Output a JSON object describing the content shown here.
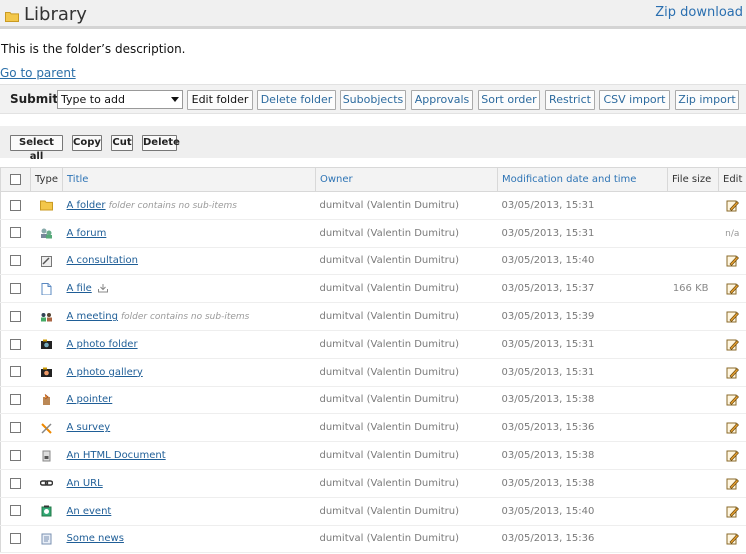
{
  "header": {
    "title": "Library",
    "zip_download": "Zip download"
  },
  "description": "This is the folder’s description.",
  "go_to_parent": "Go to parent",
  "submit": {
    "label": "Submit:",
    "select_value": "Type to add",
    "buttons": [
      "Edit folder",
      "Delete folder",
      "Subobjects",
      "Approvals",
      "Sort order",
      "Restrict",
      "CSV import",
      "Zip import"
    ]
  },
  "actions": [
    "Select all",
    "Copy",
    "Cut",
    "Delete"
  ],
  "table": {
    "headers": {
      "type": "Type",
      "title": "Title",
      "owner": "Owner",
      "modified": "Modification date and time",
      "size": "File size",
      "edit": "Edit"
    },
    "rows": [
      {
        "icon": "folder-icon",
        "title": "A folder",
        "note": "folder contains no sub-items",
        "owner": "dumitval (Valentin Dumitru)",
        "date": "03/05/2013, 15:31",
        "size": "",
        "edit": "edit-icon"
      },
      {
        "icon": "forum-icon",
        "title": "A forum",
        "note": "",
        "owner": "dumitval (Valentin Dumitru)",
        "date": "03/05/2013, 15:31",
        "size": "",
        "edit": "n/a"
      },
      {
        "icon": "consultation-icon",
        "title": "A consultation",
        "note": "",
        "owner": "dumitval (Valentin Dumitru)",
        "date": "03/05/2013, 15:40",
        "size": "",
        "edit": "edit-icon"
      },
      {
        "icon": "file-icon",
        "title": "A file",
        "note": "",
        "download": true,
        "owner": "dumitval (Valentin Dumitru)",
        "date": "03/05/2013, 15:37",
        "size": "166 KB",
        "edit": "edit-icon"
      },
      {
        "icon": "meeting-icon",
        "title": "A meeting",
        "note": "folder contains no sub-items",
        "owner": "dumitval (Valentin Dumitru)",
        "date": "03/05/2013, 15:39",
        "size": "",
        "edit": "edit-icon"
      },
      {
        "icon": "photo-folder-icon",
        "title": "A photo folder",
        "note": "",
        "owner": "dumitval (Valentin Dumitru)",
        "date": "03/05/2013, 15:31",
        "size": "",
        "edit": "edit-icon"
      },
      {
        "icon": "photo-gallery-icon",
        "title": "A photo gallery",
        "note": "",
        "owner": "dumitval (Valentin Dumitru)",
        "date": "03/05/2013, 15:31",
        "size": "",
        "edit": "edit-icon"
      },
      {
        "icon": "pointer-icon",
        "title": "A pointer",
        "note": "",
        "owner": "dumitval (Valentin Dumitru)",
        "date": "03/05/2013, 15:38",
        "size": "",
        "edit": "edit-icon"
      },
      {
        "icon": "survey-icon",
        "title": "A survey",
        "note": "",
        "owner": "dumitval (Valentin Dumitru)",
        "date": "03/05/2013, 15:36",
        "size": "",
        "edit": "edit-icon"
      },
      {
        "icon": "html-document-icon",
        "title": "An HTML Document",
        "note": "",
        "owner": "dumitval (Valentin Dumitru)",
        "date": "03/05/2013, 15:38",
        "size": "",
        "edit": "edit-icon"
      },
      {
        "icon": "url-icon",
        "title": "An URL",
        "note": "",
        "owner": "dumitval (Valentin Dumitru)",
        "date": "03/05/2013, 15:38",
        "size": "",
        "edit": "edit-icon"
      },
      {
        "icon": "event-icon",
        "title": "An event",
        "note": "",
        "owner": "dumitval (Valentin Dumitru)",
        "date": "03/05/2013, 15:40",
        "size": "",
        "edit": "edit-icon"
      },
      {
        "icon": "news-icon",
        "title": "Some news",
        "note": "",
        "owner": "dumitval (Valentin Dumitru)",
        "date": "03/05/2013, 15:36",
        "size": "",
        "edit": "edit-icon"
      }
    ]
  },
  "colors": {
    "link": "#2a6fb0",
    "header_bg": "#f0f0f0",
    "folder_yellow": "#f3c74a"
  }
}
